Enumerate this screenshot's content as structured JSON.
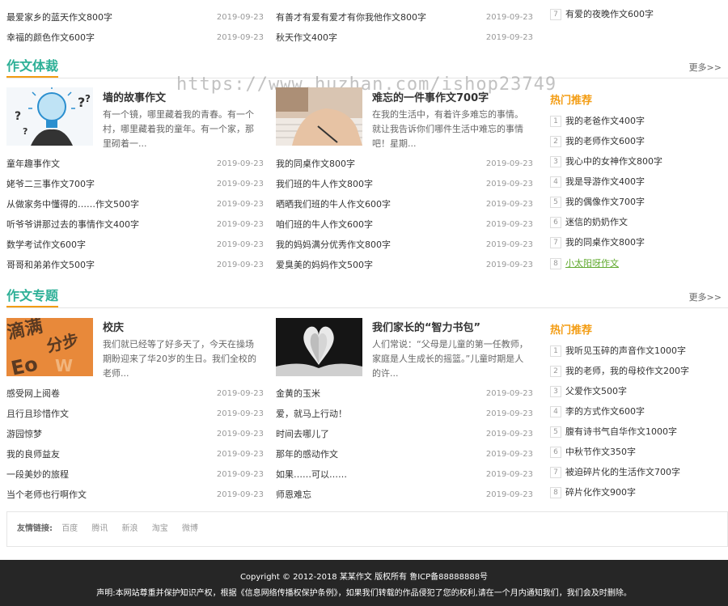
{
  "top_partial": {
    "col1": [
      {
        "title": "最爱家乡的蓝天作文800字",
        "date": "2019-09-23"
      },
      {
        "title": "幸福的颜色作文600字",
        "date": "2019-09-23"
      }
    ],
    "col2": [
      {
        "title": "有善才有爱有爱才有你我他作文800字",
        "date": "2019-09-23"
      },
      {
        "title": "秋天作文400字",
        "date": "2019-09-23"
      }
    ],
    "hot": {
      "num": "7",
      "title": "有爱的夜晚作文600字"
    }
  },
  "watermark": "https://www.huzhan.com/ishop23749",
  "section1": {
    "title": "作文体裁",
    "more": "更多>>",
    "feature1": {
      "title": "墙的故事作文",
      "desc": "有一个镜，哪里藏着我的青春。有一个村，哪里藏着我的童年。有一个家，那里砌着一..."
    },
    "feature2": {
      "title": "难忘的一件事作文700字",
      "desc": "在我的生活中，有着许多难忘的事情。就让我告诉你们哪件生活中难忘的事情吧！星期..."
    },
    "list1": [
      {
        "title": "童年趣事作文",
        "date": "2019-09-23"
      },
      {
        "title": "姥爷二三事作文700字",
        "date": "2019-09-23"
      },
      {
        "title": "从做家务中懂得的……作文500字",
        "date": "2019-09-23"
      },
      {
        "title": "听爷爷讲那过去的事情作文400字",
        "date": "2019-09-23"
      },
      {
        "title": "数学考试作文600字",
        "date": "2019-09-23"
      },
      {
        "title": "哥哥和弟弟作文500字",
        "date": "2019-09-23"
      }
    ],
    "list2": [
      {
        "title": "我的同桌作文800字",
        "date": "2019-09-23"
      },
      {
        "title": "我们班的牛人作文800字",
        "date": "2019-09-23"
      },
      {
        "title": "晒晒我们班的牛人作文600字",
        "date": "2019-09-23"
      },
      {
        "title": "咱们班的牛人作文600字",
        "date": "2019-09-23"
      },
      {
        "title": "我的妈妈满分优秀作文800字",
        "date": "2019-09-23"
      },
      {
        "title": "爱臭美的妈妈作文500字",
        "date": "2019-09-23"
      }
    ],
    "hot_title": "热门推荐",
    "hot": [
      {
        "num": "1",
        "title": "我的老爸作文400字"
      },
      {
        "num": "2",
        "title": "我的老师作文600字"
      },
      {
        "num": "3",
        "title": "我心中的女神作文800字"
      },
      {
        "num": "4",
        "title": "我是导游作文400字"
      },
      {
        "num": "5",
        "title": "我的偶像作文700字"
      },
      {
        "num": "6",
        "title": "迷信的奶奶作文"
      },
      {
        "num": "7",
        "title": "我的同桌作文800字"
      },
      {
        "num": "8",
        "title": "小太阳呀作文"
      }
    ]
  },
  "section2": {
    "title": "作文专题",
    "more": "更多>>",
    "feature1": {
      "title": "校庆",
      "desc": "我们就已经等了好多天了，今天在操场期盼迎来了华20岁的生日。我们全校的老师..."
    },
    "feature2": {
      "title": "我们家长的“智力书包”",
      "desc": "人们常说：“父母是儿童的第一任教师，家庭是人生成长的摇篮。”儿童时期是人的许..."
    },
    "list1": [
      {
        "title": "感受网上阅卷",
        "date": "2019-09-23"
      },
      {
        "title": "且行且珍惜作文",
        "date": "2019-09-23"
      },
      {
        "title": "游园惊梦",
        "date": "2019-09-23"
      },
      {
        "title": "我的良师益友",
        "date": "2019-09-23"
      },
      {
        "title": "一段美妙的旅程",
        "date": "2019-09-23"
      },
      {
        "title": "当个老师也行啊作文",
        "date": "2019-09-23"
      }
    ],
    "list2": [
      {
        "title": "金黄的玉米",
        "date": "2019-09-23"
      },
      {
        "title": "爱，就马上行动！",
        "date": "2019-09-23"
      },
      {
        "title": "时间去哪儿了",
        "date": "2019-09-23"
      },
      {
        "title": "那年的感动作文",
        "date": "2019-09-23"
      },
      {
        "title": "如果……可以……",
        "date": "2019-09-23"
      },
      {
        "title": "师恩难忘",
        "date": "2019-09-23"
      }
    ],
    "hot_title": "热门推荐",
    "hot": [
      {
        "num": "1",
        "title": "我听见玉碎的声音作文1000字"
      },
      {
        "num": "2",
        "title": "我的老师，我的母校作文200字"
      },
      {
        "num": "3",
        "title": "父爱作文500字"
      },
      {
        "num": "4",
        "title": "李的方式作文600字"
      },
      {
        "num": "5",
        "title": "腹有诗书气自华作文1000字"
      },
      {
        "num": "6",
        "title": "中秋节作文350字"
      },
      {
        "num": "7",
        "title": "被迫碎片化的生活作文700字"
      },
      {
        "num": "8",
        "title": "碎片化作文900字"
      }
    ]
  },
  "friends": {
    "label": "友情链接:",
    "links": [
      "百度",
      "腾讯",
      "新浪",
      "淘宝",
      "微博"
    ]
  },
  "footer": {
    "line1": "Copyright © 2012-2018 某某作文 版权所有   鲁ICP备88888888号",
    "line2": "声明:本网站尊重并保护知识产权，根据《信息网络传播权保护条例》，如果我们转载的作品侵犯了您的权利,请在一个月内通知我们，我们会及时删除。"
  }
}
